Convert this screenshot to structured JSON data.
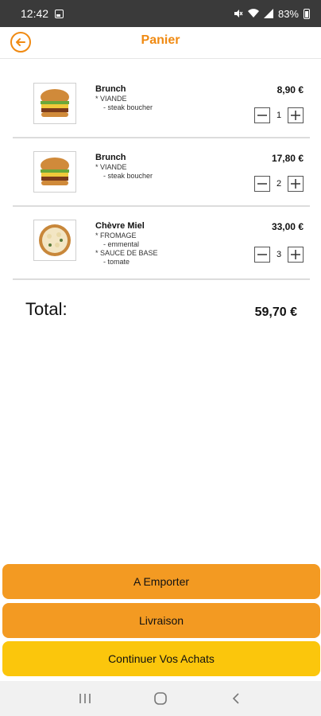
{
  "status_bar": {
    "time": "12:42",
    "battery": "83%"
  },
  "header": {
    "title": "Panier"
  },
  "cart": [
    {
      "name": "Brunch",
      "options": [
        {
          "text": "* VIANDE",
          "sub": false
        },
        {
          "text": "- steak boucher",
          "sub": true
        }
      ],
      "price": "8,90 €",
      "quantity": "1",
      "image": "burger-image"
    },
    {
      "name": "Brunch",
      "options": [
        {
          "text": "* VIANDE",
          "sub": false
        },
        {
          "text": "- steak boucher",
          "sub": true
        }
      ],
      "price": "17,80 €",
      "quantity": "2",
      "image": "burger-image"
    },
    {
      "name": "Chèvre Miel",
      "options": [
        {
          "text": "* FROMAGE",
          "sub": false
        },
        {
          "text": "- emmental",
          "sub": true
        },
        {
          "text": "* SAUCE DE BASE",
          "sub": false
        },
        {
          "text": "- tomate",
          "sub": true
        }
      ],
      "price": "33,00 €",
      "quantity": "3",
      "image": "pizza-image"
    }
  ],
  "total": {
    "label": "Total:",
    "value": "59,70 €"
  },
  "buttons": {
    "emporter": "A Emporter",
    "livraison": "Livraison",
    "continuer": "Continuer Vos Achats"
  },
  "colors": {
    "accent": "#f08a12",
    "button_orange": "#f39a22",
    "button_yellow": "#fbc60c"
  },
  "icons": {
    "back": "arrow-left-icon",
    "minus": "minus-icon",
    "plus": "plus-icon",
    "nav_recent": "recent-apps-icon",
    "nav_home": "home-icon",
    "nav_back": "back-chevron-icon"
  }
}
